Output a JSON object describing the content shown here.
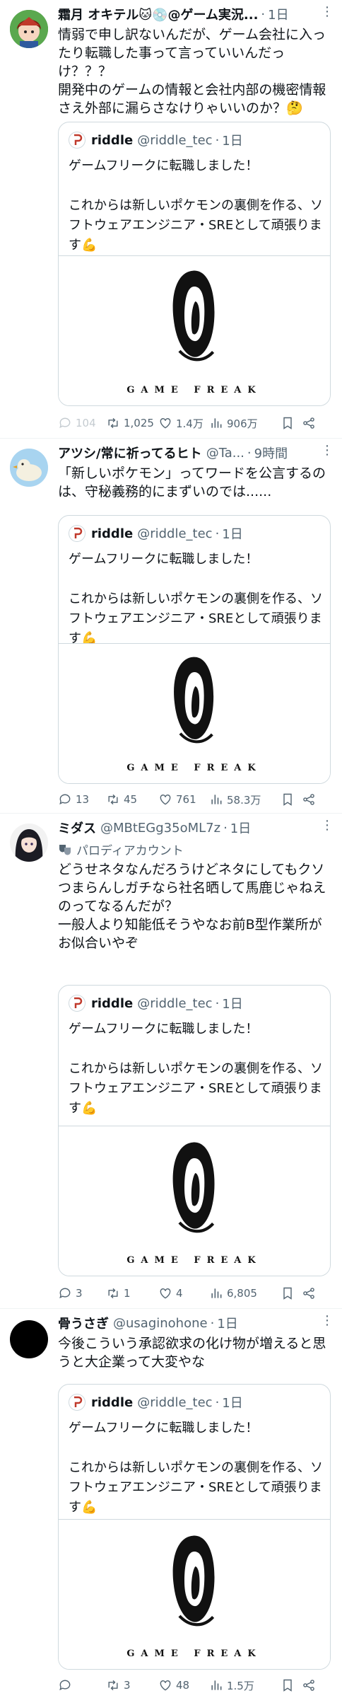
{
  "tweets": [
    {
      "name": "霜月 オキテル🐱💿@ゲーム実況...",
      "handle": "",
      "time": "1日",
      "avatar_icon": "anime-character-avatar",
      "text": "情弱で申し訳ないんだが、ゲーム会社に入ったり転職した事って言っていいんだっけ？？？\n開発中のゲームの情報と会社内部の機密情報さえ外部に漏らさなけりゃいいのか？🤔",
      "quote": {
        "name": "riddle",
        "handle": "@riddle_tec",
        "time": "1日",
        "text": "ゲームフリークに転職しました！\n\nこれからは新しいポケモンの裏側を作る、ソフトウェアエンジニア・SREとして頑張ります💪",
        "media_caption": "GAME FREAK"
      },
      "stats": {
        "replies": "104",
        "retweets": "1,025",
        "likes": "1.4万",
        "views": "906万"
      }
    },
    {
      "name": "アツシ/常に祈ってるヒト",
      "handle": "@Ta...",
      "time": "9時間",
      "avatar_icon": "duck-avatar",
      "text": "「新しいポケモン」ってワードを公言するのは、守秘義務的にまずいのでは......",
      "quote": {
        "name": "riddle",
        "handle": "@riddle_tec",
        "time": "1日",
        "text": "ゲームフリークに転職しました！\n\nこれからは新しいポケモンの裏側を作る、ソフトウェアエンジニア・SREとして頑張ります💪",
        "media_caption": "GAME FREAK"
      },
      "stats": {
        "replies": "13",
        "retweets": "45",
        "likes": "761",
        "views": "58.3万"
      }
    },
    {
      "name": "ミダス",
      "handle": "@MBtEGg35oML7z",
      "time": "1日",
      "avatar_icon": "anime-girl-avatar",
      "parody_label": "パロディアカウント",
      "text": "どうせネタなんだろうけどネタにしてもクソつまらんしガチなら社名晒して馬鹿じゃねえのってなるんだが？\n一般人より知能低そうやなお前B型作業所がお似合いやぞ",
      "quote": {
        "name": "riddle",
        "handle": "@riddle_tec",
        "time": "1日",
        "text": "ゲームフリークに転職しました！\n\nこれからは新しいポケモンの裏側を作る、ソフトウェアエンジニア・SREとして頑張ります💪",
        "media_caption": "GAME FREAK"
      },
      "stats": {
        "replies": "3",
        "retweets": "1",
        "likes": "4",
        "views": "6,805"
      }
    },
    {
      "name": "骨うさぎ",
      "handle": "@usaginohone",
      "time": "1日",
      "avatar_icon": "black-circle-avatar",
      "text": "今後こういう承認欲求の化け物が増えると思うと大企業って大変やな",
      "quote": {
        "name": "riddle",
        "handle": "@riddle_tec",
        "time": "1日",
        "text": "ゲームフリークに転職しました！\n\nこれからは新しいポケモンの裏側を作る、ソフトウェアエンジニア・SREとして頑張ります💪",
        "media_caption": "GAME FREAK"
      },
      "stats": {
        "replies": "",
        "retweets": "3",
        "likes": "48",
        "views": "1.5万"
      }
    }
  ],
  "more_icon": "more-dots-icon",
  "colors": {
    "text": "#0f1419",
    "secondary": "#536471",
    "border": "#cfd9de",
    "verified": "#1d9bf0"
  }
}
